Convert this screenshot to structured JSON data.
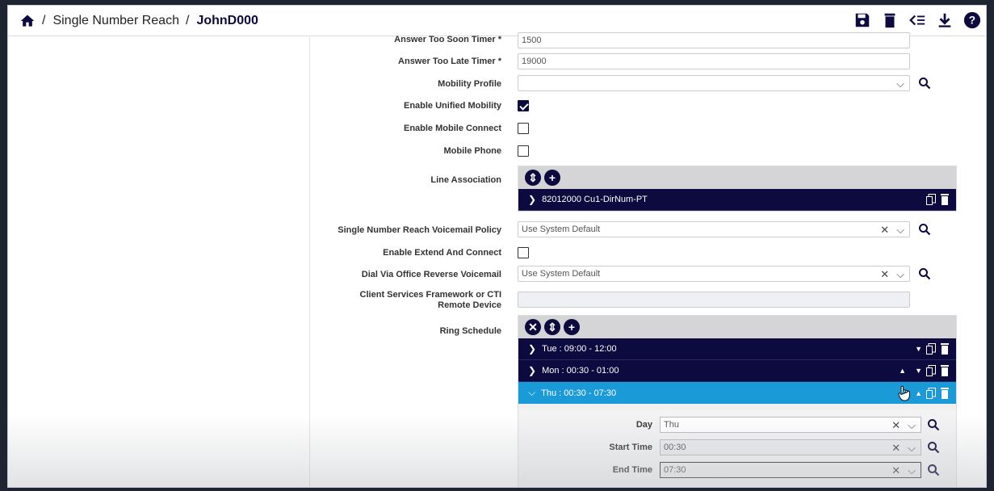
{
  "breadcrumb": {
    "sep": "/",
    "section": "Single Number Reach",
    "item": "JohnD000"
  },
  "toolbar": {
    "icons": [
      "save-icon",
      "delete-icon",
      "list-icon",
      "download-icon",
      "help-icon"
    ]
  },
  "fields": {
    "answer_too_soon": {
      "label": "Answer Too Soon Timer *",
      "value": "1500"
    },
    "answer_too_late": {
      "label": "Answer Too Late Timer *",
      "value": "19000"
    },
    "mobility_profile": {
      "label": "Mobility Profile",
      "value": ""
    },
    "enable_unified_mobility": {
      "label": "Enable Unified Mobility",
      "checked": true
    },
    "enable_mobile_connect": {
      "label": "Enable Mobile Connect",
      "checked": false
    },
    "mobile_phone": {
      "label": "Mobile Phone",
      "checked": false
    },
    "line_association": {
      "label": "Line Association",
      "items": [
        "82012000 Cu1-DirNum-PT"
      ]
    },
    "snr_voicemail_policy": {
      "label": "Single Number Reach Voicemail Policy",
      "value": "Use System Default"
    },
    "enable_extend_connect": {
      "label": "Enable Extend And Connect",
      "checked": false
    },
    "dvo_reverse_voicemail": {
      "label": "Dial Via Office Reverse Voicemail",
      "value": "Use System Default"
    },
    "csf_device": {
      "label": "Client Services Framework or CTI Remote Device",
      "value": ""
    },
    "ring_schedule": {
      "label": "Ring Schedule",
      "items": [
        "Tue : 09:00 - 12:00",
        "Mon : 00:30 - 01:00",
        "Thu : 00:30 - 07:30"
      ],
      "expanded": {
        "day_label": "Day",
        "day_value": "Thu",
        "start_label": "Start Time",
        "start_value": "00:30",
        "end_label": "End Time",
        "end_value": "07:30"
      }
    }
  },
  "colors": {
    "navy": "#0c0a3e",
    "accent_blue": "#1a9ad6"
  }
}
